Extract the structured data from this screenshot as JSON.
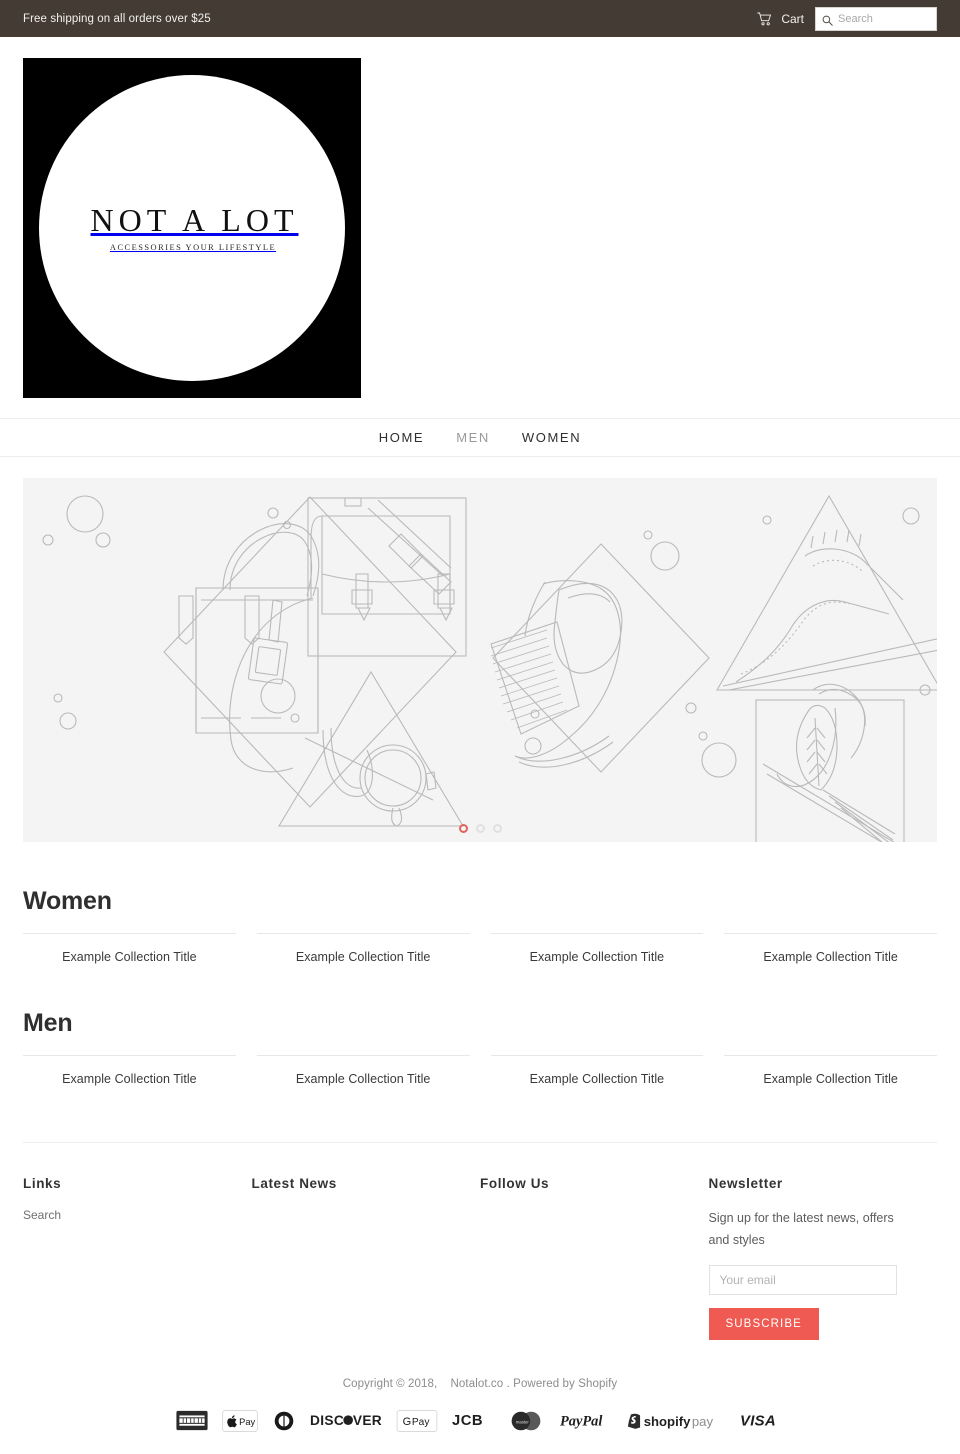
{
  "announcement": {
    "text": "Free shipping on all orders over $25",
    "cart_label": "Cart",
    "cart_icon": "shopping-cart-icon",
    "search_icon": "search-icon",
    "search_placeholder": "Search",
    "search_value": "",
    "bar_color": "#443c34"
  },
  "logo": {
    "name": "NOT A LOT",
    "tagline": "ACCESSORIES YOUR LIFESTYLE"
  },
  "nav": {
    "items": [
      {
        "label": "HOME",
        "state": "active"
      },
      {
        "label": "MEN",
        "state": "dim"
      },
      {
        "label": "WOMEN",
        "state": "active"
      }
    ]
  },
  "slideshow": {
    "slide_count": 3,
    "active_slide": 1,
    "background": "#f4f4f4",
    "active_dot_color": "#e0635c",
    "dot_color": "#e0e0e0",
    "placeholder_alt": "accessories line art placeholder"
  },
  "collections": [
    {
      "title": "Women",
      "items": [
        {
          "name": "Example Collection Title"
        },
        {
          "name": "Example Collection Title"
        },
        {
          "name": "Example Collection Title"
        },
        {
          "name": "Example Collection Title"
        }
      ]
    },
    {
      "title": "Men",
      "items": [
        {
          "name": "Example Collection Title"
        },
        {
          "name": "Example Collection Title"
        },
        {
          "name": "Example Collection Title"
        },
        {
          "name": "Example Collection Title"
        }
      ]
    }
  ],
  "footer": {
    "links": {
      "heading": "Links",
      "items": [
        {
          "label": "Search"
        }
      ]
    },
    "latest_news": {
      "heading": "Latest News"
    },
    "follow_us": {
      "heading": "Follow Us"
    },
    "newsletter": {
      "heading": "Newsletter",
      "text": "Sign up for the latest news, offers and styles",
      "email_placeholder": "Your email",
      "email_value": "",
      "subscribe_label": "SUBSCRIBE",
      "button_color": "#ef5a52"
    },
    "copyright_prefix": "Copyright © 2018,",
    "shop_name": "Notalot.co",
    "copyright_suffix": ". Powered by Shopify",
    "payments": [
      {
        "name": "american-express"
      },
      {
        "name": "apple-pay"
      },
      {
        "name": "diners-club"
      },
      {
        "name": "discover"
      },
      {
        "name": "google-pay"
      },
      {
        "name": "jcb"
      },
      {
        "name": "master"
      },
      {
        "name": "paypal"
      },
      {
        "name": "shopify-pay"
      },
      {
        "name": "visa"
      }
    ]
  }
}
